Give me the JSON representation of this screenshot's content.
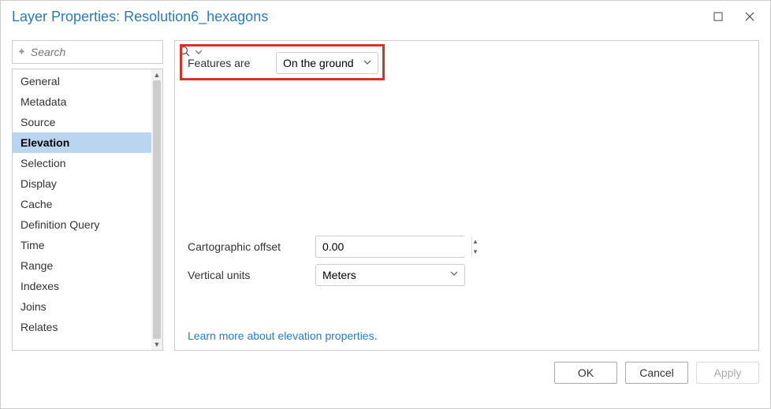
{
  "title": "Layer Properties: Resolution6_hexagons",
  "search": {
    "placeholder": "Search"
  },
  "nav": {
    "items": [
      "General",
      "Metadata",
      "Source",
      "Elevation",
      "Selection",
      "Display",
      "Cache",
      "Definition Query",
      "Time",
      "Range",
      "Indexes",
      "Joins",
      "Relates"
    ],
    "active_index": 3
  },
  "main": {
    "features_are_label": "Features are",
    "features_are_value": "On the ground",
    "offset_label": "Cartographic offset",
    "offset_value": "0.00",
    "units_label": "Vertical units",
    "units_value": "Meters",
    "link_text": "Learn more about elevation properties."
  },
  "footer": {
    "ok": "OK",
    "cancel": "Cancel",
    "apply": "Apply"
  }
}
